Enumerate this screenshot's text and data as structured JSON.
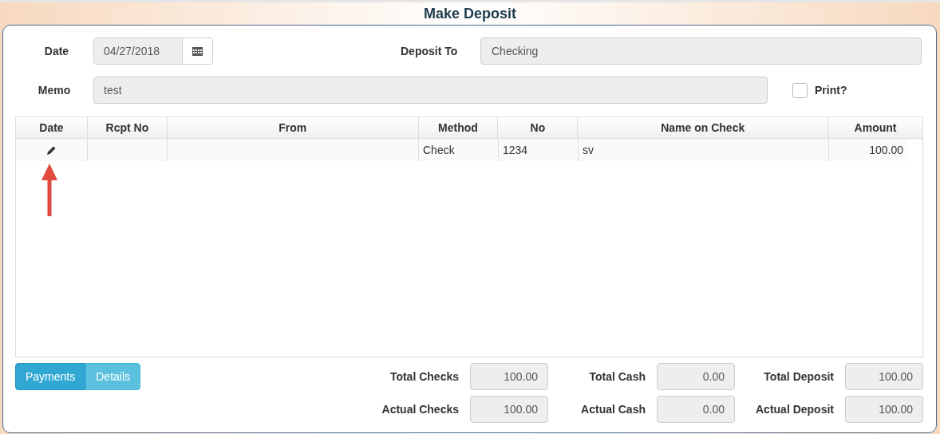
{
  "title": "Make Deposit",
  "form": {
    "date_label": "Date",
    "date_value": "04/27/2018",
    "deposit_to_label": "Deposit To",
    "deposit_to_value": "Checking",
    "memo_label": "Memo",
    "memo_value": "test",
    "print_label": "Print?",
    "print_checked": false
  },
  "table": {
    "columns": [
      "Date",
      "Rcpt No",
      "From",
      "Method",
      "No",
      "Name on Check",
      "Amount"
    ],
    "rows": [
      {
        "cells": [
          "",
          "",
          "",
          "Check",
          "1234",
          "sv",
          "100.00"
        ],
        "editable": true
      }
    ]
  },
  "tabs": [
    {
      "label": "Payments",
      "selected": true
    },
    {
      "label": "Details",
      "selected": false
    }
  ],
  "totals": [
    {
      "label": "Total Checks",
      "value": "100.00"
    },
    {
      "label": "Total Cash",
      "value": "0.00"
    },
    {
      "label": "Total Deposit",
      "value": "100.00"
    },
    {
      "label": "Actual Checks",
      "value": "100.00"
    },
    {
      "label": "Actual Cash",
      "value": "0.00"
    },
    {
      "label": "Actual Deposit",
      "value": "100.00"
    }
  ]
}
